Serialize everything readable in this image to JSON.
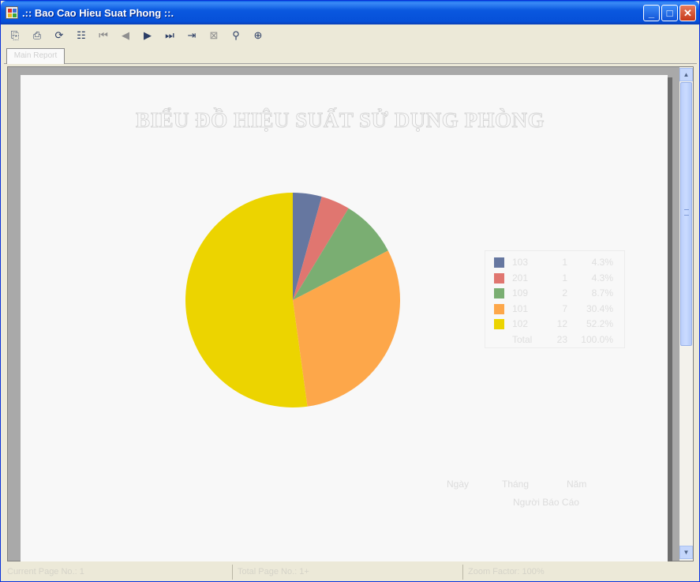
{
  "window": {
    "title": ".:: Bao Cao Hieu Suat Phong ::.",
    "controls": {
      "minimize": "_",
      "maximize": "□",
      "close": "✕"
    }
  },
  "toolbar": {
    "buttons": [
      {
        "name": "export-icon",
        "glyph": "⎘",
        "enabled": true
      },
      {
        "name": "print-icon",
        "glyph": "⎙",
        "enabled": true
      },
      {
        "name": "refresh-icon",
        "glyph": "⟳",
        "enabled": true
      },
      {
        "name": "group-tree-icon",
        "glyph": "☷",
        "enabled": true
      },
      {
        "name": "first-page-icon",
        "glyph": "⏮",
        "enabled": false
      },
      {
        "name": "previous-page-icon",
        "glyph": "◀",
        "enabled": false
      },
      {
        "name": "next-page-icon",
        "glyph": "▶",
        "enabled": true
      },
      {
        "name": "last-page-icon",
        "glyph": "⏭",
        "enabled": true
      },
      {
        "name": "goto-page-icon",
        "glyph": "⇥",
        "enabled": true
      },
      {
        "name": "stop-icon",
        "glyph": "⊠",
        "enabled": false
      },
      {
        "name": "search-icon",
        "glyph": "⚲",
        "enabled": true
      },
      {
        "name": "zoom-icon",
        "glyph": "⊕",
        "enabled": true
      }
    ]
  },
  "tabs": [
    {
      "label": "Main Report"
    }
  ],
  "report": {
    "title": "BIỂU ĐỒ HIỆU SUẤT SỬ DỤNG PHÒNG",
    "date_labels": [
      "Ngày",
      "Tháng",
      "Năm"
    ],
    "signer_label": "Người Báo Cáo"
  },
  "chart_data": {
    "type": "pie",
    "title": "",
    "slices": [
      {
        "label": "103",
        "value": 1,
        "percent": "4.3%",
        "color": "#6677a0"
      },
      {
        "label": "201",
        "value": 1,
        "percent": "4.3%",
        "color": "#e07670"
      },
      {
        "label": "109",
        "value": 2,
        "percent": "8.7%",
        "color": "#7aae72"
      },
      {
        "label": "101",
        "value": 7,
        "percent": "30.4%",
        "color": "#fda74a"
      },
      {
        "label": "102",
        "value": 12,
        "percent": "52.2%",
        "color": "#ecd400"
      }
    ],
    "total": {
      "label": "Total",
      "value": 23,
      "percent": "100.0%"
    },
    "legend_position": "right"
  },
  "status": {
    "current_page": "Current Page No.: 1",
    "total_page": "Total Page No.: 1+",
    "zoom": "Zoom Factor: 100%"
  },
  "colors": {
    "titlebar": "#0a58df",
    "window_bg": "#ece9d8",
    "viewer_bg": "#a9a9a9",
    "paper_bg": "#f8f8f8"
  }
}
